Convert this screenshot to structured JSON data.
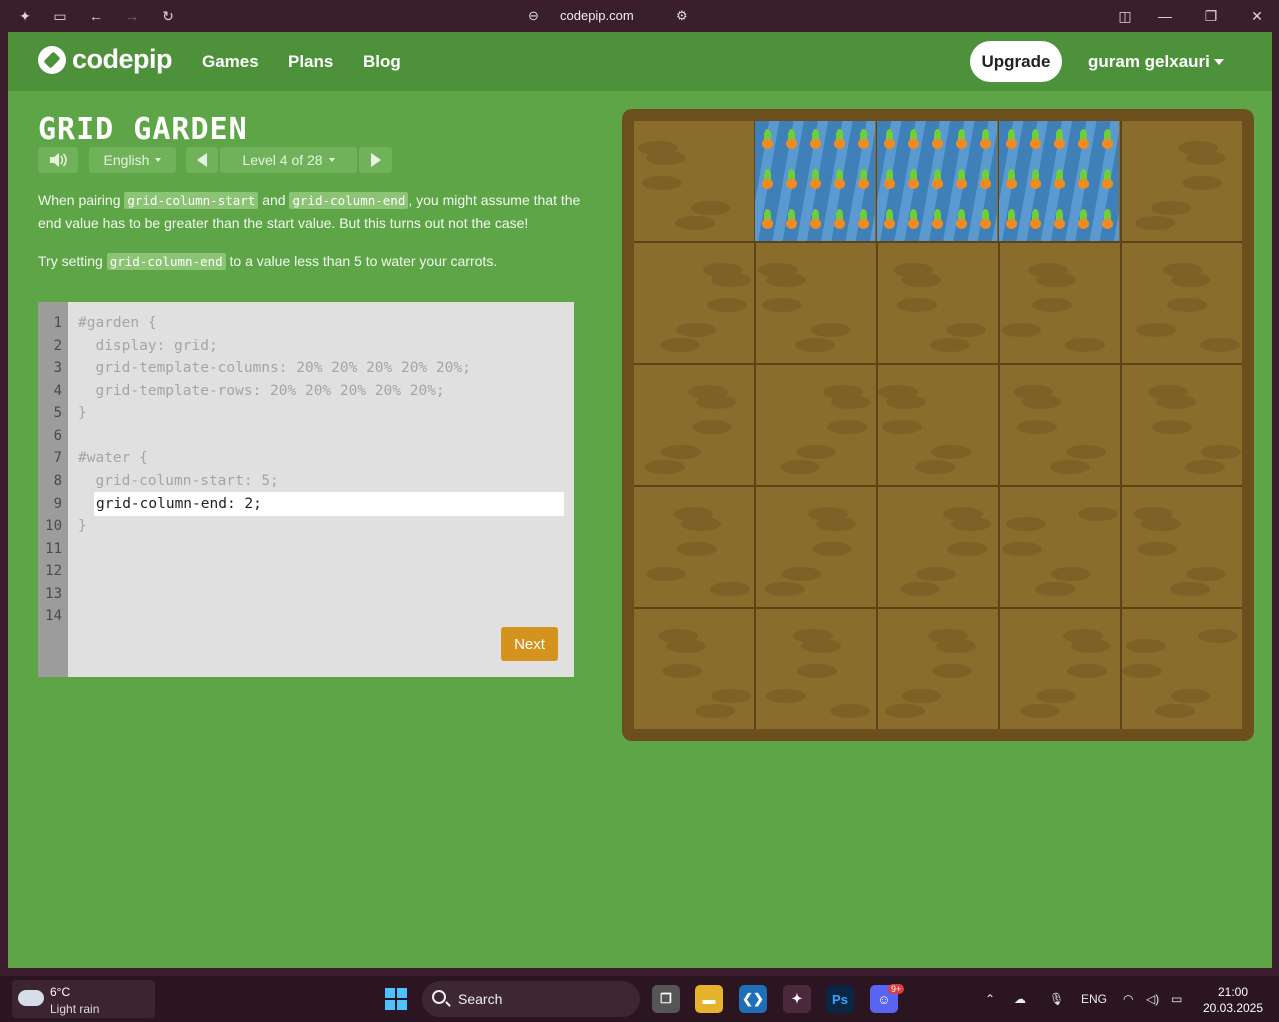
{
  "browser": {
    "url": "codepip.com"
  },
  "nav": {
    "brand": "codepip",
    "links": [
      "Games",
      "Plans",
      "Blog"
    ],
    "upgrade_label": "Upgrade",
    "user_name": "guram gelxauri"
  },
  "game": {
    "title": "GRID GARDEN",
    "language": "English",
    "level_label": "Level 4 of 28",
    "instructions": {
      "p1_before": "When pairing ",
      "p1_code1": "grid-column-start",
      "p1_mid": " and ",
      "p1_code2": "grid-column-end",
      "p1_after": ", you might assume that the end value has to be greater than the start value. But this turns out not the case!",
      "p2_before": "Try setting ",
      "p2_code": "grid-column-end",
      "p2_after": " to a value less than 5 to water your carrots."
    },
    "editor": {
      "line_numbers": [
        "1",
        "2",
        "3",
        "4",
        "5",
        "6",
        "7",
        "8",
        "9",
        "10",
        "11",
        "12",
        "13",
        "14"
      ],
      "lines": [
        "#garden {",
        "  display: grid;",
        "  grid-template-columns: 20% 20% 20% 20% 20%;",
        "  grid-template-rows: 20% 20% 20% 20% 20%;",
        "}",
        "",
        "#water {",
        "  grid-column-start: 5;",
        "",
        "}"
      ],
      "input_value": "grid-column-end: 2;",
      "next_label": "Next"
    },
    "garden": {
      "rows": 5,
      "columns": 5,
      "water_columns": [
        2,
        3,
        4
      ],
      "water_row": 1
    }
  },
  "taskbar": {
    "weather_temp": "6°C",
    "weather_desc": "Light rain",
    "search_label": "Search",
    "lang": "ENG",
    "time": "21:00",
    "date": "20.03.2025",
    "discord_badge": "9+"
  },
  "colors": {
    "page_bg": "#5ea548",
    "nav_bg": "#4d923a",
    "soil": "#8a6c2d",
    "water": "#3f80b9",
    "next_button": "#d3931e"
  }
}
